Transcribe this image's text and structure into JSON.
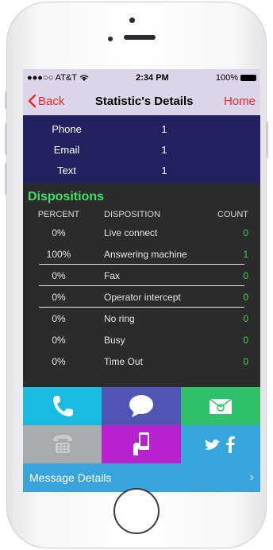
{
  "status_bar": {
    "carrier": "●●●○○ AT&T",
    "time": "2:34 PM",
    "battery": "100%",
    "wifi_icon": "wifi-icon"
  },
  "nav": {
    "back_label": "Back",
    "title": "Statistic's Details",
    "home_label": "Home"
  },
  "summary": {
    "rows": [
      {
        "label": "Phone",
        "value": "1"
      },
      {
        "label": "Email",
        "value": "1"
      },
      {
        "label": "Text",
        "value": "1"
      }
    ]
  },
  "dispositions": {
    "title": "Dispositions",
    "headers": {
      "percent": "PERCENT",
      "disposition": "DISPOSITION",
      "count": "COUNT"
    },
    "rows": [
      {
        "percent": "0%",
        "disposition": "Live connect",
        "count": "0"
      },
      {
        "percent": "100%",
        "disposition": "Answering machine",
        "count": "1"
      },
      {
        "percent": "0%",
        "disposition": "Fax",
        "count": "0"
      },
      {
        "percent": "0%",
        "disposition": "Operator intercept",
        "count": "0"
      },
      {
        "percent": "0%",
        "disposition": "No ring",
        "count": "0"
      },
      {
        "percent": "0%",
        "disposition": "Busy",
        "count": "0"
      },
      {
        "percent": "0%",
        "disposition": "Time Out",
        "count": "0"
      }
    ]
  },
  "tiles": [
    {
      "icon": "phone-icon",
      "color": "#17bce0"
    },
    {
      "icon": "chat-bubble-icon",
      "color": "#4e55b3"
    },
    {
      "icon": "email-icon",
      "color": "#2fc06b"
    },
    {
      "icon": "telephone-keypad-icon",
      "color": "#a8abad"
    },
    {
      "icon": "mobile-hand-icon",
      "color": "#b722ce"
    },
    {
      "icon": "twitter-facebook-icon",
      "color": "#37a6dc"
    }
  ],
  "message_details": {
    "label": "Message Details"
  },
  "colors": {
    "accent_red": "#e8262d",
    "nav_bg": "#ddd5ea",
    "summary_bg": "#22205e",
    "dispositions_green": "#3ee06a",
    "body_bg": "#2b2b2b"
  }
}
